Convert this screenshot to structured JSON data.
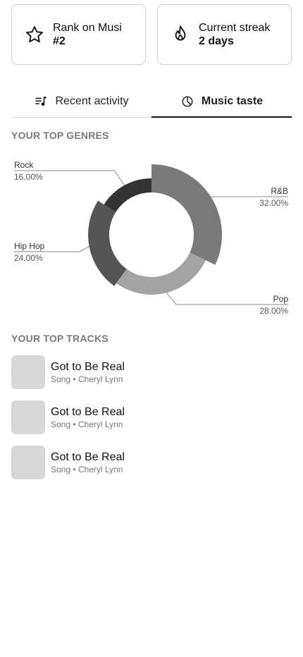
{
  "stats": {
    "rank": {
      "label": "Rank on Musi",
      "value": "#2",
      "icon": "star-icon"
    },
    "streak": {
      "label": "Current streak",
      "value": "2 days",
      "icon": "flame-icon"
    }
  },
  "tabs": [
    {
      "label": "Recent activity",
      "icon": "queue-music-icon",
      "active": false
    },
    {
      "label": "Music taste",
      "icon": "pie-chart-icon",
      "active": true
    }
  ],
  "genres_title": "YOUR TOP GENRES",
  "tracks_title": "YOUR TOP TRACKS",
  "chart_data": {
    "type": "pie",
    "style": "donut",
    "categories": [
      "R&B",
      "Pop",
      "Hip Hop",
      "Rock"
    ],
    "values": [
      32.0,
      28.0,
      24.0,
      16.0
    ],
    "value_labels": [
      "32.00%",
      "28.00%",
      "24.00%",
      "16.00%"
    ],
    "colors": [
      "#7a7a7a",
      "#a3a3a3",
      "#555555",
      "#333333"
    ],
    "title": "",
    "legend": "none"
  },
  "tracks": [
    {
      "title": "Got to Be Real",
      "meta": "Song • Cheryl Lynn"
    },
    {
      "title": "Got to Be Real",
      "meta": "Song • Cheryl Lynn"
    },
    {
      "title": "Got to Be Real",
      "meta": "Song • Cheryl Lynn"
    }
  ]
}
